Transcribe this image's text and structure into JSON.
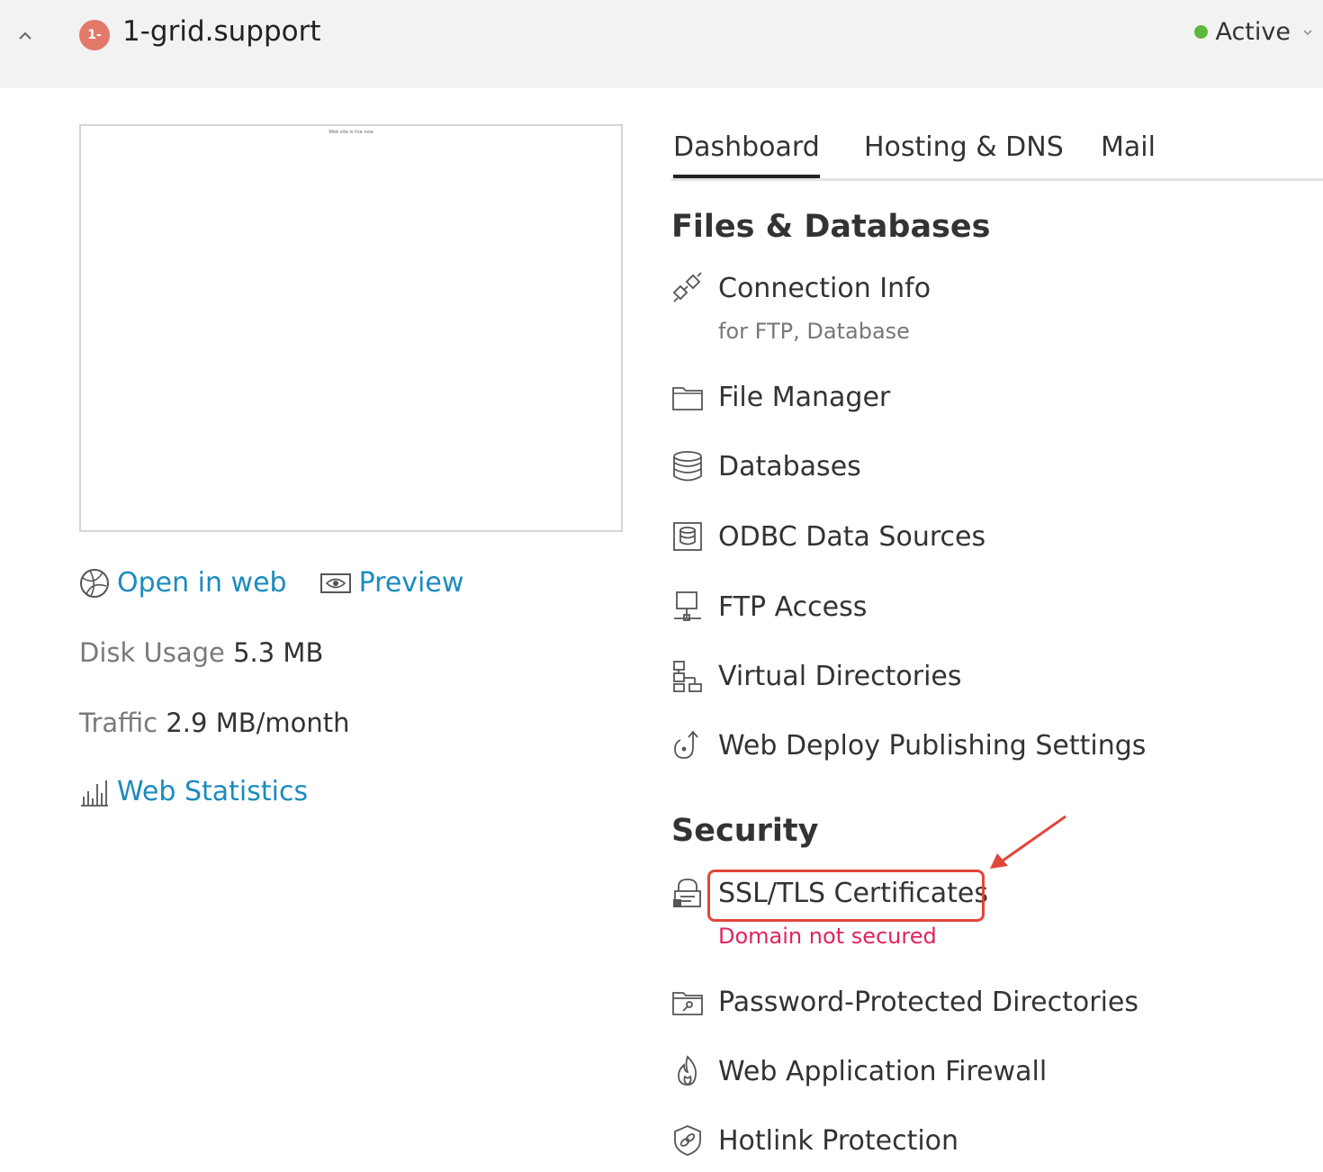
{
  "header": {
    "badge_text": "1-",
    "domain": "1-grid.support",
    "status": "Active",
    "status_color": "#5cb83c",
    "collapse_icon": "chevron-up-icon",
    "dropdown_icon": "chevron-down-icon"
  },
  "preview": {
    "caption": "Web site is live now"
  },
  "actions": {
    "open_in_web": "Open in web",
    "preview": "Preview"
  },
  "stats": {
    "disk_label": "Disk Usage",
    "disk_value": "5.3 MB",
    "traffic_label": "Traffic",
    "traffic_value": "2.9 MB/month",
    "web_statistics": "Web Statistics"
  },
  "tabs": [
    {
      "label": "Dashboard",
      "active": true
    },
    {
      "label": "Hosting & DNS",
      "active": false
    },
    {
      "label": "Mail",
      "active": false
    }
  ],
  "files_section": {
    "title": "Files & Databases",
    "items": [
      {
        "label": "Connection Info",
        "sub": "for FTP, Database",
        "icon": "plug-icon"
      },
      {
        "label": "File Manager",
        "icon": "folder-icon"
      },
      {
        "label": "Databases",
        "icon": "database-icon"
      },
      {
        "label": "ODBC Data Sources",
        "icon": "odbc-icon"
      },
      {
        "label": "FTP Access",
        "icon": "ftp-icon"
      },
      {
        "label": "Virtual Directories",
        "icon": "virtual-directories-icon"
      },
      {
        "label": "Web Deploy Publishing Settings",
        "icon": "web-deploy-icon"
      }
    ]
  },
  "security_section": {
    "title": "Security",
    "items": [
      {
        "label": "SSL/TLS Certificates",
        "sub": "Domain not secured",
        "icon": "certificate-icon"
      },
      {
        "label": "Password-Protected Directories",
        "icon": "protected-folder-icon"
      },
      {
        "label": "Web Application Firewall",
        "icon": "firewall-icon"
      },
      {
        "label": "Hotlink Protection",
        "icon": "hotlink-shield-icon"
      }
    ]
  },
  "colors": {
    "link": "#1b8bbf",
    "warning": "#e0245e",
    "annotation": "#e0463a"
  }
}
